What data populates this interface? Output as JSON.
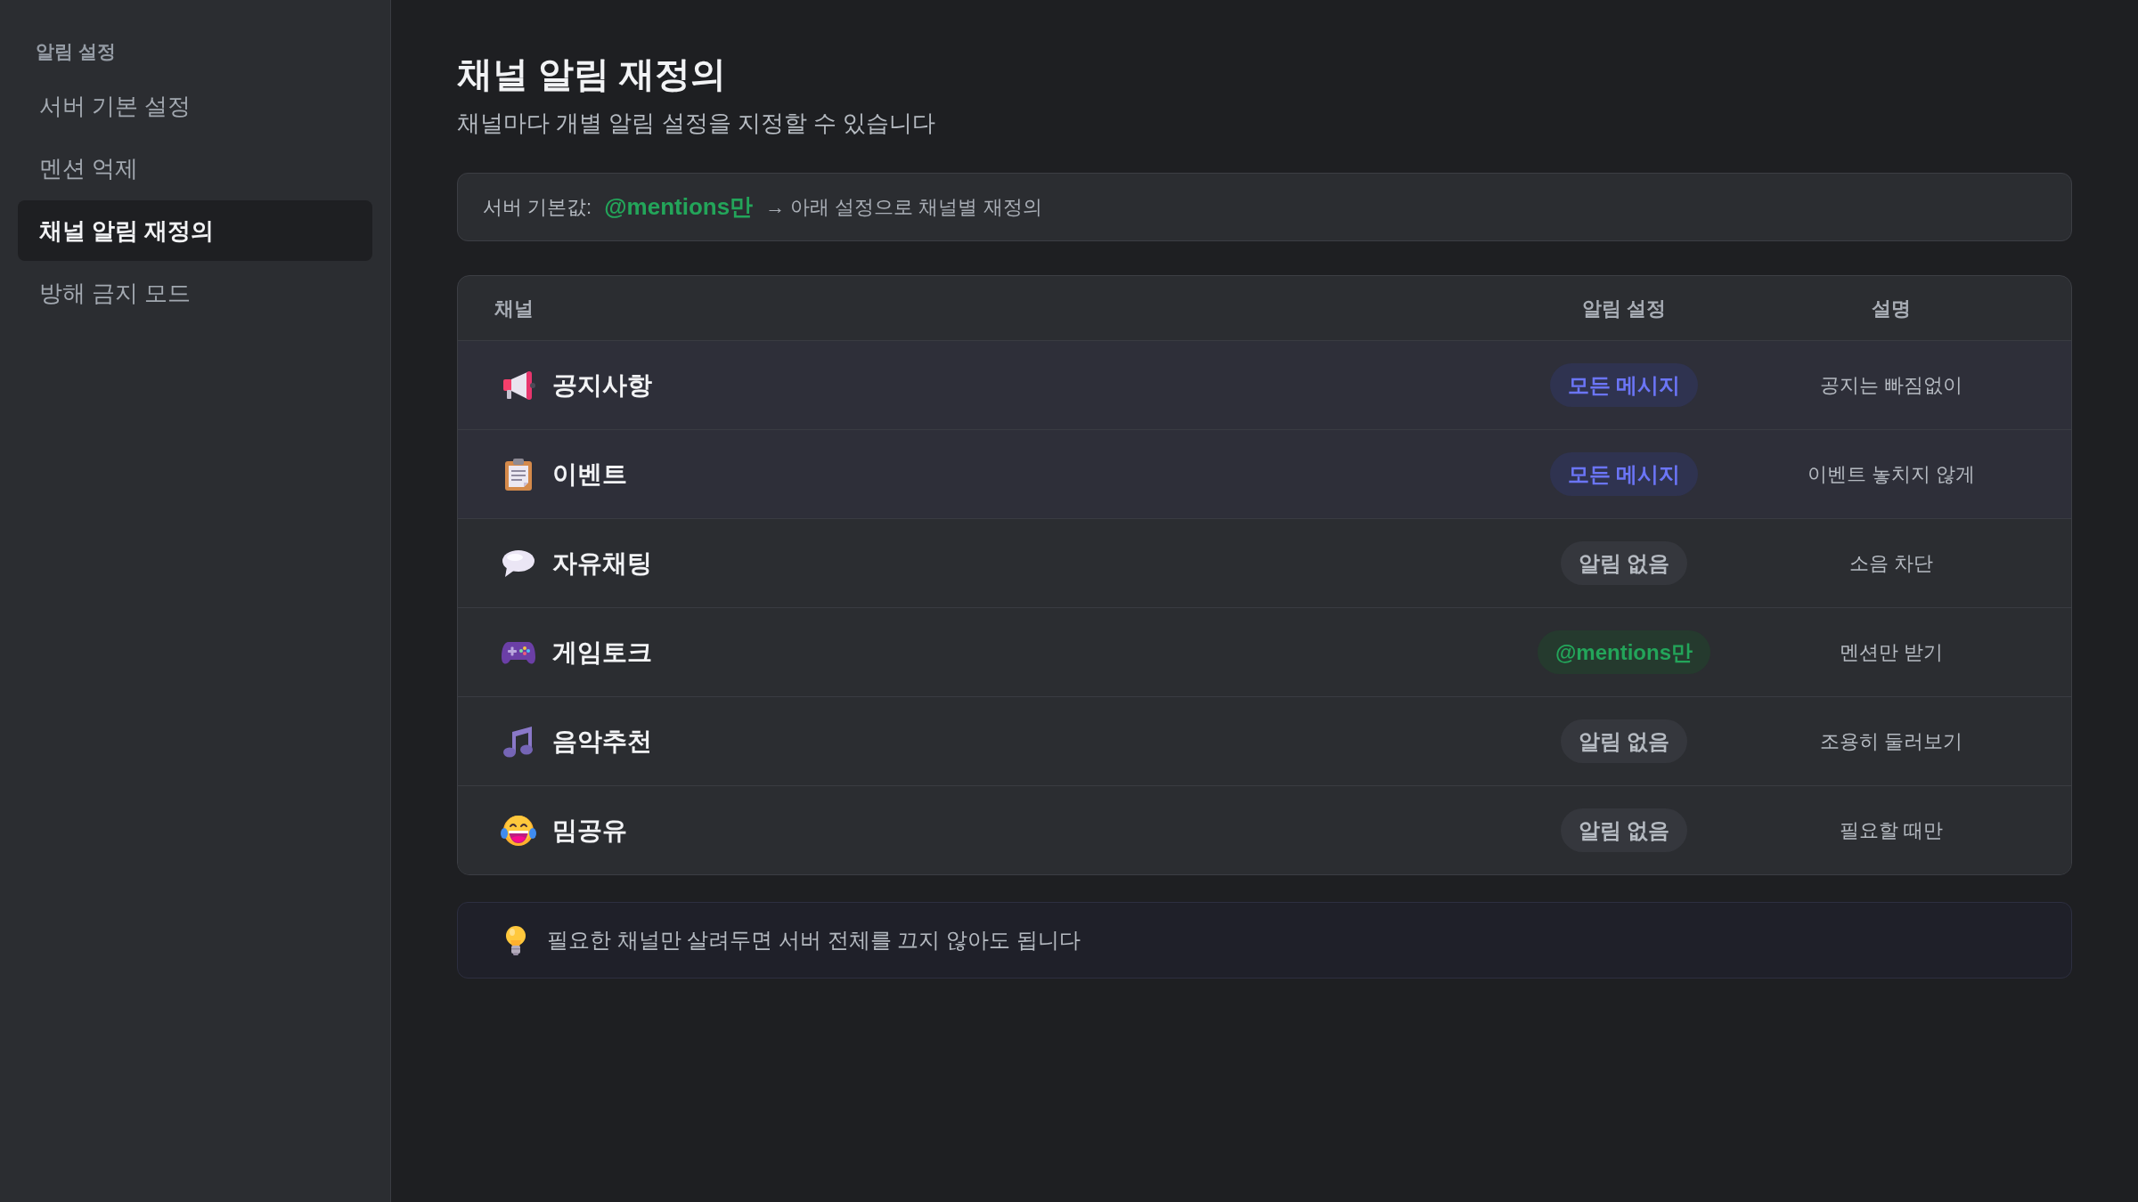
{
  "sidebar": {
    "heading": "알림 설정",
    "items": [
      {
        "label": "서버 기본 설정",
        "selected": false
      },
      {
        "label": "멘션 억제",
        "selected": false
      },
      {
        "label": "채널 알림 재정의",
        "selected": true
      },
      {
        "label": "방해 금지 모드",
        "selected": false
      }
    ]
  },
  "page": {
    "title": "채널 알림 재정의",
    "subtitle": "채널마다 개별 알림 설정을 지정할 수 있습니다"
  },
  "banner": {
    "label": "서버 기본값:",
    "value": "@mentions만",
    "note": "→ 아래 설정으로 채널별 재정의"
  },
  "table": {
    "columns": [
      "채널",
      "알림 설정",
      "설명"
    ],
    "rows": [
      {
        "channel": "공지사항",
        "setting": {
          "label": "모든 메시지",
          "kind": "all"
        },
        "description": "공지는 빠짐없이"
      },
      {
        "channel": "이벤트",
        "setting": {
          "label": "모든 메시지",
          "kind": "all"
        },
        "description": "이벤트 놓치지 않게"
      },
      {
        "channel": "자유채팅",
        "setting": {
          "label": "알림 없음",
          "kind": "none"
        },
        "description": "소음 차단"
      },
      {
        "channel": "게임토크",
        "setting": {
          "label": "@mentions만",
          "kind": "mentions"
        },
        "description": "멘션만 받기"
      },
      {
        "channel": "음악추천",
        "setting": {
          "label": "알림 없음",
          "kind": "none"
        },
        "description": "조용히 둘러보기"
      },
      {
        "channel": "밈공유",
        "setting": {
          "label": "알림 없음",
          "kind": "none"
        },
        "description": "필요할 때만"
      }
    ]
  },
  "tip": {
    "text": "필요한 채널만 살려두면 서버 전체를 끄지 않아도 됩니다"
  }
}
